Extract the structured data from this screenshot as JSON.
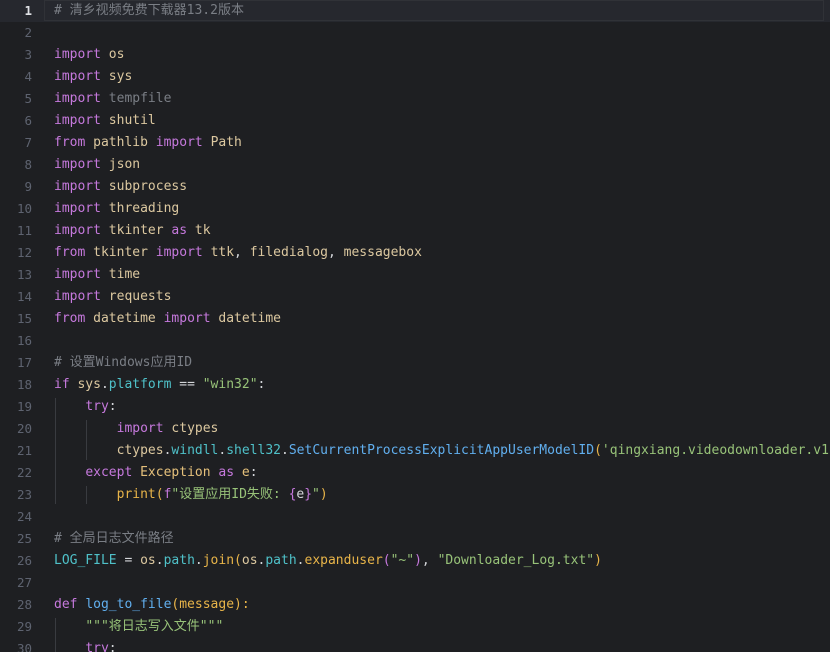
{
  "editor": {
    "language": "python",
    "current_line": 1,
    "colors": {
      "background": "#1e1f22",
      "keyword": "#c679dd",
      "module": "#dcc8a0",
      "function": "#61afef",
      "attribute": "#4fc1c9",
      "string": "#98c379",
      "class": "#e5c07b",
      "comment": "#7a7e85",
      "line_number": "#5e6370"
    },
    "lines": [
      {
        "num": "1",
        "tokens": [
          {
            "t": "# 清乡视频免费下载器13.2版本",
            "c": "cm"
          }
        ]
      },
      {
        "num": "2",
        "tokens": []
      },
      {
        "num": "3",
        "tokens": [
          {
            "t": "import",
            "c": "kw"
          },
          {
            "t": " ",
            "c": "pl"
          },
          {
            "t": "os",
            "c": "mod"
          }
        ]
      },
      {
        "num": "4",
        "tokens": [
          {
            "t": "import",
            "c": "kw"
          },
          {
            "t": " ",
            "c": "pl"
          },
          {
            "t": "sys",
            "c": "mod"
          }
        ]
      },
      {
        "num": "5",
        "tokens": [
          {
            "t": "import",
            "c": "kw"
          },
          {
            "t": " ",
            "c": "pl"
          },
          {
            "t": "tempfile",
            "c": "dim"
          }
        ]
      },
      {
        "num": "6",
        "tokens": [
          {
            "t": "import",
            "c": "kw"
          },
          {
            "t": " ",
            "c": "pl"
          },
          {
            "t": "shutil",
            "c": "mod"
          }
        ]
      },
      {
        "num": "7",
        "tokens": [
          {
            "t": "from",
            "c": "kw"
          },
          {
            "t": " ",
            "c": "pl"
          },
          {
            "t": "pathlib",
            "c": "mod"
          },
          {
            "t": " ",
            "c": "pl"
          },
          {
            "t": "import",
            "c": "kw"
          },
          {
            "t": " ",
            "c": "pl"
          },
          {
            "t": "Path",
            "c": "mod"
          }
        ]
      },
      {
        "num": "8",
        "tokens": [
          {
            "t": "import",
            "c": "kw"
          },
          {
            "t": " ",
            "c": "pl"
          },
          {
            "t": "json",
            "c": "mod"
          }
        ]
      },
      {
        "num": "9",
        "tokens": [
          {
            "t": "import",
            "c": "kw"
          },
          {
            "t": " ",
            "c": "pl"
          },
          {
            "t": "subprocess",
            "c": "mod"
          }
        ]
      },
      {
        "num": "10",
        "tokens": [
          {
            "t": "import",
            "c": "kw"
          },
          {
            "t": " ",
            "c": "pl"
          },
          {
            "t": "threading",
            "c": "mod"
          }
        ]
      },
      {
        "num": "11",
        "tokens": [
          {
            "t": "import",
            "c": "kw"
          },
          {
            "t": " ",
            "c": "pl"
          },
          {
            "t": "tkinter",
            "c": "mod"
          },
          {
            "t": " ",
            "c": "pl"
          },
          {
            "t": "as",
            "c": "kw"
          },
          {
            "t": " ",
            "c": "pl"
          },
          {
            "t": "tk",
            "c": "mod"
          }
        ]
      },
      {
        "num": "12",
        "tokens": [
          {
            "t": "from",
            "c": "kw"
          },
          {
            "t": " ",
            "c": "pl"
          },
          {
            "t": "tkinter",
            "c": "mod"
          },
          {
            "t": " ",
            "c": "pl"
          },
          {
            "t": "import",
            "c": "kw"
          },
          {
            "t": " ",
            "c": "pl"
          },
          {
            "t": "ttk",
            "c": "mod"
          },
          {
            "t": ", ",
            "c": "op"
          },
          {
            "t": "filedialog",
            "c": "mod"
          },
          {
            "t": ", ",
            "c": "op"
          },
          {
            "t": "messagebox",
            "c": "mod"
          }
        ]
      },
      {
        "num": "13",
        "tokens": [
          {
            "t": "import",
            "c": "kw"
          },
          {
            "t": " ",
            "c": "pl"
          },
          {
            "t": "time",
            "c": "mod"
          }
        ]
      },
      {
        "num": "14",
        "tokens": [
          {
            "t": "import",
            "c": "kw"
          },
          {
            "t": " ",
            "c": "pl"
          },
          {
            "t": "requests",
            "c": "mod"
          }
        ]
      },
      {
        "num": "15",
        "tokens": [
          {
            "t": "from",
            "c": "kw"
          },
          {
            "t": " ",
            "c": "pl"
          },
          {
            "t": "datetime",
            "c": "mod"
          },
          {
            "t": " ",
            "c": "pl"
          },
          {
            "t": "import",
            "c": "kw"
          },
          {
            "t": " ",
            "c": "pl"
          },
          {
            "t": "datetime",
            "c": "mod"
          }
        ]
      },
      {
        "num": "16",
        "tokens": []
      },
      {
        "num": "17",
        "tokens": [
          {
            "t": "# 设置Windows应用ID",
            "c": "cm"
          }
        ]
      },
      {
        "num": "18",
        "tokens": [
          {
            "t": "if",
            "c": "kw"
          },
          {
            "t": " ",
            "c": "pl"
          },
          {
            "t": "sys",
            "c": "mod"
          },
          {
            "t": ".",
            "c": "op"
          },
          {
            "t": "platform",
            "c": "at"
          },
          {
            "t": " == ",
            "c": "op"
          },
          {
            "t": "\"win32\"",
            "c": "str"
          },
          {
            "t": ":",
            "c": "op"
          }
        ]
      },
      {
        "num": "19",
        "tokens": [
          {
            "t": "    ",
            "c": "pl"
          },
          {
            "t": "try",
            "c": "kw"
          },
          {
            "t": ":",
            "c": "op"
          }
        ]
      },
      {
        "num": "20",
        "tokens": [
          {
            "t": "        ",
            "c": "pl"
          },
          {
            "t": "import",
            "c": "kw"
          },
          {
            "t": " ",
            "c": "pl"
          },
          {
            "t": "ctypes",
            "c": "mod"
          }
        ]
      },
      {
        "num": "21",
        "tokens": [
          {
            "t": "        ",
            "c": "pl"
          },
          {
            "t": "ctypes",
            "c": "mod"
          },
          {
            "t": ".",
            "c": "op"
          },
          {
            "t": "windll",
            "c": "at"
          },
          {
            "t": ".",
            "c": "op"
          },
          {
            "t": "shell32",
            "c": "at"
          },
          {
            "t": ".",
            "c": "op"
          },
          {
            "t": "SetCurrentProcessExplicitAppUserModelID",
            "c": "fn"
          },
          {
            "t": "(",
            "c": "br"
          },
          {
            "t": "'qingxiang.videodownloader.v1",
            "c": "str"
          }
        ]
      },
      {
        "num": "22",
        "tokens": [
          {
            "t": "    ",
            "c": "pl"
          },
          {
            "t": "except",
            "c": "kw"
          },
          {
            "t": " ",
            "c": "pl"
          },
          {
            "t": "Exception",
            "c": "cls"
          },
          {
            "t": " ",
            "c": "pl"
          },
          {
            "t": "as",
            "c": "kw"
          },
          {
            "t": " ",
            "c": "pl"
          },
          {
            "t": "e",
            "c": "cls"
          },
          {
            "t": ":",
            "c": "op"
          }
        ]
      },
      {
        "num": "23",
        "tokens": [
          {
            "t": "        ",
            "c": "pl"
          },
          {
            "t": "print",
            "c": "br"
          },
          {
            "t": "(",
            "c": "br"
          },
          {
            "t": "f",
            "c": "kw"
          },
          {
            "t": "\"设置应用ID失败: ",
            "c": "str"
          },
          {
            "t": "{",
            "c": "kw"
          },
          {
            "t": "e",
            "c": "pl"
          },
          {
            "t": "}",
            "c": "kw"
          },
          {
            "t": "\"",
            "c": "str"
          },
          {
            "t": ")",
            "c": "br"
          }
        ]
      },
      {
        "num": "24",
        "tokens": []
      },
      {
        "num": "25",
        "tokens": [
          {
            "t": "# 全局日志文件路径",
            "c": "cm"
          }
        ]
      },
      {
        "num": "26",
        "tokens": [
          {
            "t": "LOG_FILE",
            "c": "var"
          },
          {
            "t": " = ",
            "c": "op"
          },
          {
            "t": "os",
            "c": "mod"
          },
          {
            "t": ".",
            "c": "op"
          },
          {
            "t": "path",
            "c": "at"
          },
          {
            "t": ".",
            "c": "op"
          },
          {
            "t": "join",
            "c": "br"
          },
          {
            "t": "(",
            "c": "br"
          },
          {
            "t": "os",
            "c": "mod"
          },
          {
            "t": ".",
            "c": "op"
          },
          {
            "t": "path",
            "c": "at"
          },
          {
            "t": ".",
            "c": "op"
          },
          {
            "t": "expanduser",
            "c": "br"
          },
          {
            "t": "(",
            "c": "kw"
          },
          {
            "t": "\"~\"",
            "c": "str"
          },
          {
            "t": ")",
            "c": "kw"
          },
          {
            "t": ", ",
            "c": "op"
          },
          {
            "t": "\"Downloader_Log.txt\"",
            "c": "str"
          },
          {
            "t": ")",
            "c": "br"
          }
        ]
      },
      {
        "num": "27",
        "tokens": []
      },
      {
        "num": "28",
        "tokens": [
          {
            "t": "def",
            "c": "kw"
          },
          {
            "t": " ",
            "c": "pl"
          },
          {
            "t": "log_to_file",
            "c": "fn"
          },
          {
            "t": "(",
            "c": "br"
          },
          {
            "t": "message",
            "c": "br"
          },
          {
            "t": "):",
            "c": "br"
          }
        ]
      },
      {
        "num": "29",
        "tokens": [
          {
            "t": "    ",
            "c": "pl"
          },
          {
            "t": "\"\"\"将日志写入文件\"\"\"",
            "c": "str"
          }
        ]
      },
      {
        "num": "30",
        "tokens": [
          {
            "t": "    ",
            "c": "pl"
          },
          {
            "t": "try",
            "c": "kw"
          },
          {
            "t": ":",
            "c": "op"
          }
        ]
      }
    ]
  }
}
